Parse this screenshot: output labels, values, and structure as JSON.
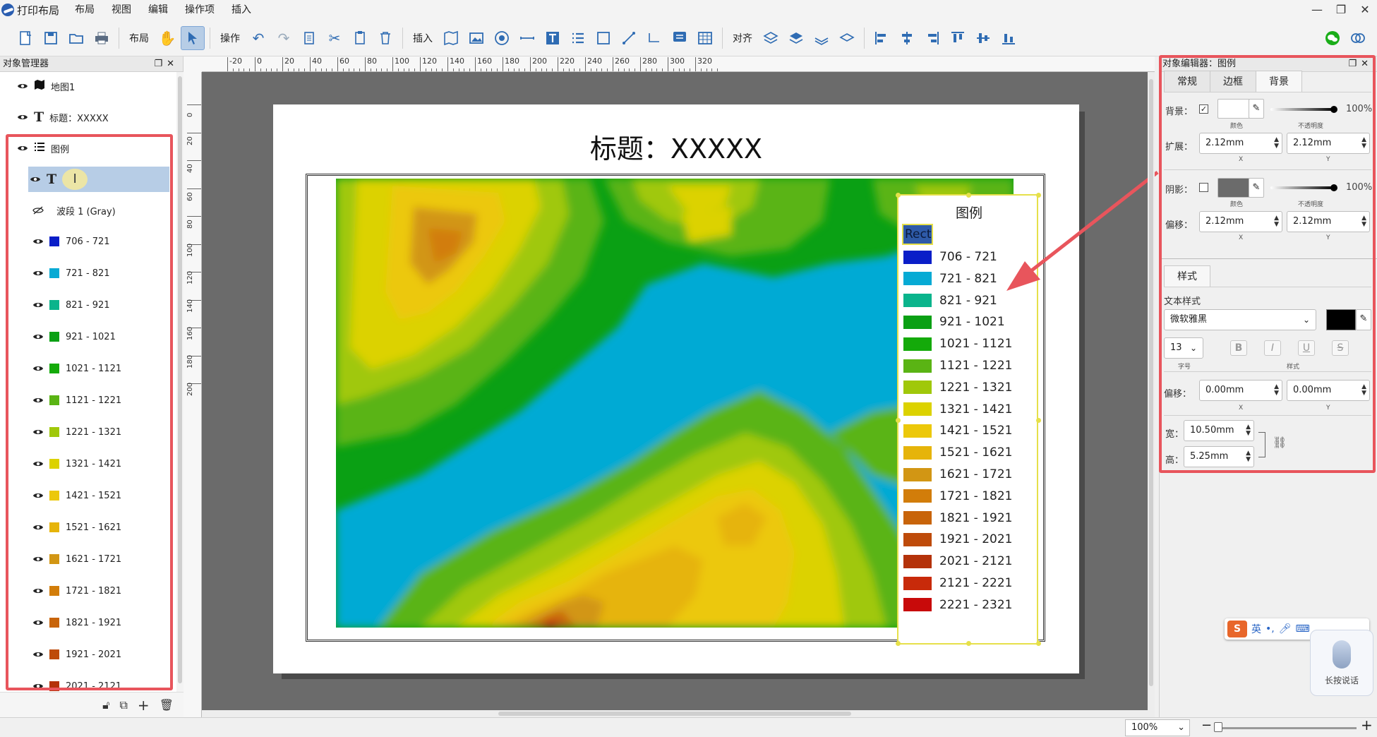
{
  "menubar": {
    "app_title": "打印布局",
    "items": [
      "布局",
      "视图",
      "编辑",
      "操作项",
      "插入"
    ],
    "window_controls": [
      "minimize-icon",
      "restore-icon",
      "close-icon"
    ]
  },
  "toolbar": {
    "layout_label": "布局",
    "operate_label": "操作",
    "insert_label": "插入",
    "align_label": "对齐"
  },
  "object_manager": {
    "title": "对象管理器",
    "items": [
      {
        "icon": "map-icon",
        "label": "地图1"
      },
      {
        "icon": "text-icon",
        "label": "标题：XXXXX"
      },
      {
        "icon": "legend-icon",
        "label": "图例"
      },
      {
        "icon": "text-icon",
        "label": ""
      },
      {
        "icon": "eye-hidden-icon",
        "label": "波段 1 (Gray)"
      }
    ],
    "classes": [
      {
        "label": "706 - 721",
        "color": "#0a1ec8"
      },
      {
        "label": "721 - 821",
        "color": "#06aad4"
      },
      {
        "label": "821 - 921",
        "color": "#0ab48c"
      },
      {
        "label": "921 - 1021",
        "color": "#0aa014"
      },
      {
        "label": "1021 - 1121",
        "color": "#14aa0a"
      },
      {
        "label": "1121 - 1221",
        "color": "#5ab414"
      },
      {
        "label": "1221 - 1321",
        "color": "#a0c80a"
      },
      {
        "label": "1321 - 1421",
        "color": "#dcd200"
      },
      {
        "label": "1421 - 1521",
        "color": "#ecc80a"
      },
      {
        "label": "1521 - 1621",
        "color": "#e6b40a"
      },
      {
        "label": "1621 - 1721",
        "color": "#d29614"
      },
      {
        "label": "1721 - 1821",
        "color": "#d27d0a"
      },
      {
        "label": "1821 - 1921",
        "color": "#c8640a"
      },
      {
        "label": "1921 - 2021",
        "color": "#be4b0a"
      },
      {
        "label": "2021 - 2121",
        "color": "#b4320a"
      },
      {
        "label": "2121 - 2221",
        "color": "#c82a0a"
      },
      {
        "label": "2221 - 2321",
        "color": "#c80a0a"
      }
    ],
    "bottom_actions": [
      "lock-icon",
      "copy-icon",
      "add-icon",
      "delete-icon"
    ]
  },
  "rulers": {
    "top": [
      "-20",
      "0",
      "20",
      "40",
      "60",
      "80",
      "100",
      "120",
      "140",
      "160",
      "180",
      "200",
      "220",
      "240",
      "260",
      "280",
      "300",
      "320"
    ],
    "left": [
      "0",
      "20",
      "40",
      "60",
      "80",
      "100",
      "120",
      "140",
      "160",
      "180",
      "200"
    ]
  },
  "page": {
    "title": "标题：XXXXX",
    "legend_title": "图例",
    "legend_rect_label": "Rect"
  },
  "object_editor": {
    "title": "对象编辑器：图例",
    "tabs": [
      "常规",
      "边框",
      "背景"
    ],
    "active_tab": "背景",
    "background": {
      "label": "背景：",
      "checked": true,
      "color_caption": "颜色",
      "opacity": "100%",
      "opacity_caption": "不透明度"
    },
    "expand": {
      "label": "扩展：",
      "x": "2.12mm",
      "y": "2.12mm",
      "x_caption": "X",
      "y_caption": "Y"
    },
    "shadow": {
      "label": "阴影：",
      "checked": false,
      "color": "#6b6b6b",
      "color_caption": "颜色",
      "opacity": "100%",
      "opacity_caption": "不透明度"
    },
    "offset": {
      "label": "偏移：",
      "x": "2.12mm",
      "y": "2.12mm",
      "x_caption": "X",
      "y_caption": "Y"
    },
    "style_tab": "样式",
    "text_style_label": "文本样式",
    "font": "微软雅黑",
    "font_color": "#000000",
    "font_size": "13",
    "font_size_caption": "字号",
    "style_caption": "样式",
    "text_offset": {
      "label": "偏移：",
      "x": "0.00mm",
      "y": "0.00mm",
      "x_caption": "X",
      "y_caption": "Y"
    },
    "width": {
      "label": "宽：",
      "value": "10.50mm"
    },
    "height": {
      "label": "高：",
      "value": "5.25mm"
    }
  },
  "statusbar": {
    "zoom": "100%"
  },
  "ime": {
    "lang": "英",
    "voice_hint": "长按说话"
  },
  "colors": {
    "highlight": "#e8555c",
    "selection": "#e6e04a",
    "accent": "#2f6cb3"
  }
}
